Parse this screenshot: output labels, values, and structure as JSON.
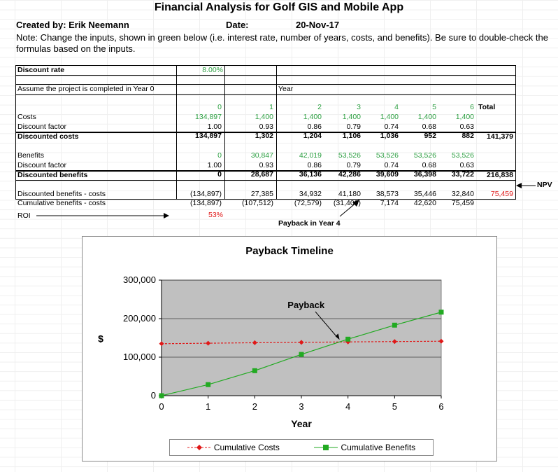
{
  "title": "Financial Analysis for Golf GIS and Mobile App",
  "created_label": "Created by: Erik Neemann",
  "date_label": "Date:",
  "date_value": "20-Nov-17",
  "note": "Note: Change the inputs, shown in green below (i.e. interest rate, number of years, costs, and benefits). Be sure to double-check the formulas based on the inputs.",
  "table": {
    "discount_rate_label": "Discount rate",
    "discount_rate_value": "8.00%",
    "assume_label": "Assume the project is completed in Year 0",
    "year_label": "Year",
    "years": [
      "0",
      "1",
      "2",
      "3",
      "4",
      "5",
      "6"
    ],
    "total_label": "Total",
    "costs_label": "Costs",
    "costs": [
      "134,897",
      "1,400",
      "1,400",
      "1,400",
      "1,400",
      "1,400",
      "1,400"
    ],
    "df_label": "Discount factor",
    "df_costs": [
      "1.00",
      "0.93",
      "0.86",
      "0.79",
      "0.74",
      "0.68",
      "0.63"
    ],
    "disc_costs_label": "Discounted costs",
    "disc_costs": [
      "134,897",
      "1,302",
      "1,204",
      "1,106",
      "1,036",
      "952",
      "882"
    ],
    "disc_costs_total": "141,379",
    "benefits_label": "Benefits",
    "benefits": [
      "0",
      "30,847",
      "42,019",
      "53,526",
      "53,526",
      "53,526",
      "53,526"
    ],
    "df_benefits": [
      "1.00",
      "0.93",
      "0.86",
      "0.79",
      "0.74",
      "0.68",
      "0.63"
    ],
    "disc_benefits_label": "Discounted benefits",
    "disc_benefits": [
      "0",
      "28,687",
      "36,136",
      "42,286",
      "39,609",
      "36,398",
      "33,722"
    ],
    "disc_benefits_total": "216,838",
    "dbc_label": "Discounted benefits - costs",
    "dbc": [
      "(134,897)",
      "27,385",
      "34,932",
      "41,180",
      "38,573",
      "35,446",
      "32,840"
    ],
    "dbc_total": "75,459",
    "cbc_label": "Cumulative benefits - costs",
    "cbc": [
      "(134,897)",
      "(107,512)",
      "(72,579)",
      "(31,400)",
      "7,174",
      "42,620",
      "75,459"
    ],
    "npv_label": "NPV",
    "roi_label": "ROI",
    "roi_value": "53%",
    "payback_note": "Payback in Year 4"
  },
  "chart_data": {
    "type": "line",
    "title": "Payback Timeline",
    "xlabel": "Year",
    "ylabel": "$",
    "x": [
      0,
      1,
      2,
      3,
      4,
      5,
      6
    ],
    "xlim": [
      0,
      6
    ],
    "ylim": [
      0,
      300000
    ],
    "y_ticks": [
      0,
      100000,
      200000,
      300000
    ],
    "y_tick_labels": [
      "0",
      "100,000",
      "200,000",
      "300,000"
    ],
    "grid": true,
    "legend_position": "bottom",
    "annotation": "Payback",
    "series": [
      {
        "name": "Cumulative Costs",
        "color": "#e01818",
        "marker": "diamond",
        "dashed": true,
        "values": [
          134897,
          136199,
          137403,
          138509,
          139545,
          140497,
          141379
        ]
      },
      {
        "name": "Cumulative Benefits",
        "color": "#22aa22",
        "marker": "square",
        "dashed": false,
        "values": [
          0,
          28687,
          64823,
          107109,
          146718,
          183116,
          216838
        ]
      }
    ],
    "plot_bg": "#c0c0c0"
  }
}
